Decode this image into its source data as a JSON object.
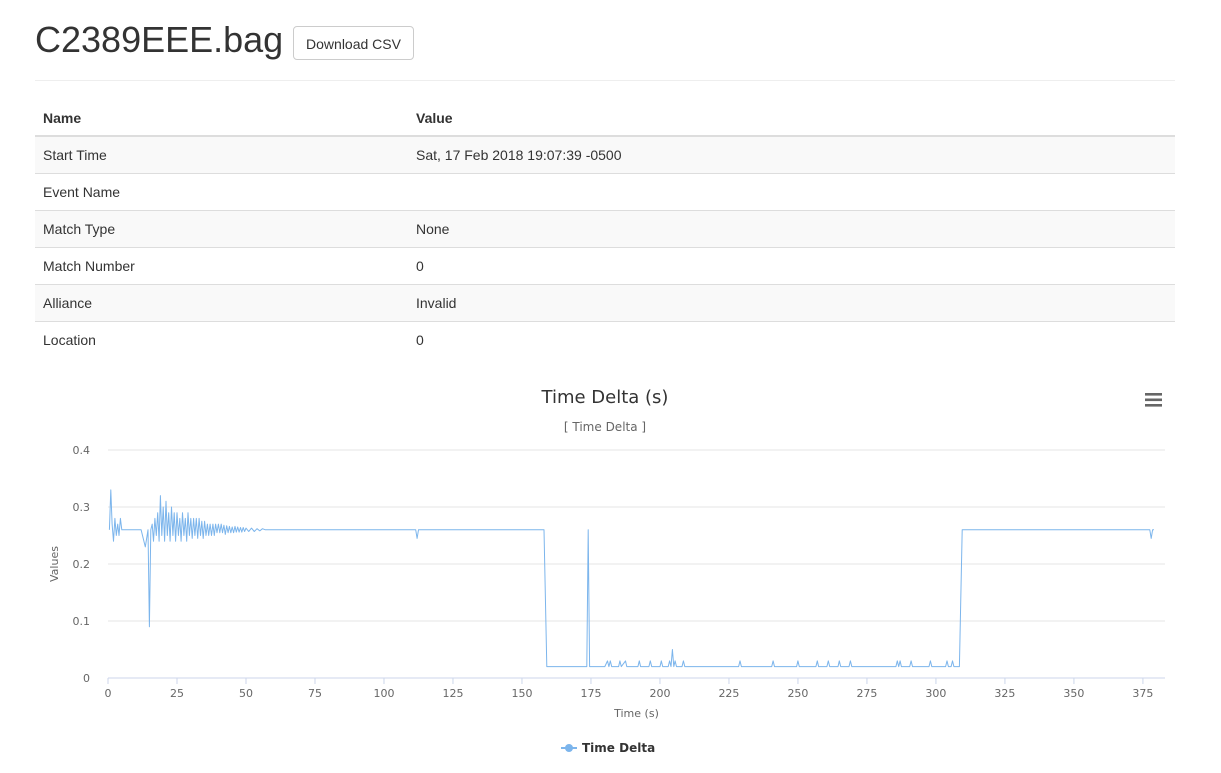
{
  "header": {
    "title": "C2389EEE.bag",
    "download_label": "Download CSV"
  },
  "table": {
    "headers": [
      "Name",
      "Value"
    ],
    "rows": [
      {
        "name": "Start Time",
        "value": "Sat, 17 Feb 2018 19:07:39 -0500"
      },
      {
        "name": "Event Name",
        "value": ""
      },
      {
        "name": "Match Type",
        "value": "None"
      },
      {
        "name": "Match Number",
        "value": "0"
      },
      {
        "name": "Alliance",
        "value": "Invalid"
      },
      {
        "name": "Location",
        "value": "0"
      }
    ]
  },
  "chart_menu_icon": "hamburger-menu-icon",
  "chart_data": {
    "type": "line",
    "title": "Time Delta (s)",
    "subtitle": "[ Time Delta ]",
    "xlabel": "Time (s)",
    "ylabel": "Values",
    "xlim": [
      0,
      383
    ],
    "ylim": [
      0,
      0.4
    ],
    "x_ticks": [
      0,
      25,
      50,
      75,
      100,
      125,
      150,
      175,
      200,
      225,
      250,
      275,
      300,
      325,
      350,
      375
    ],
    "y_ticks": [
      0,
      0.1,
      0.2,
      0.3,
      0.4
    ],
    "grid": true,
    "legend_position": "bottom-center",
    "series": [
      {
        "name": "Time Delta",
        "color": "#7cb5ec",
        "points": [
          [
            0.5,
            0.26
          ],
          [
            1.0,
            0.33
          ],
          [
            1.5,
            0.27
          ],
          [
            2.0,
            0.24
          ],
          [
            2.5,
            0.28
          ],
          [
            3.0,
            0.25
          ],
          [
            3.5,
            0.27
          ],
          [
            4.0,
            0.25
          ],
          [
            4.5,
            0.28
          ],
          [
            5.0,
            0.26
          ],
          [
            6.0,
            0.26
          ],
          [
            8.0,
            0.26
          ],
          [
            10.0,
            0.26
          ],
          [
            12.0,
            0.26
          ],
          [
            13.5,
            0.23
          ],
          [
            14.5,
            0.26
          ],
          [
            15.0,
            0.09
          ],
          [
            15.5,
            0.26
          ],
          [
            16.0,
            0.27
          ],
          [
            16.5,
            0.24
          ],
          [
            17.0,
            0.28
          ],
          [
            17.5,
            0.25
          ],
          [
            18.0,
            0.29
          ],
          [
            18.5,
            0.24
          ],
          [
            19.0,
            0.32
          ],
          [
            19.5,
            0.25
          ],
          [
            20.0,
            0.3
          ],
          [
            20.5,
            0.24
          ],
          [
            21.0,
            0.31
          ],
          [
            21.5,
            0.25
          ],
          [
            22.0,
            0.29
          ],
          [
            22.5,
            0.24
          ],
          [
            23.0,
            0.3
          ],
          [
            23.5,
            0.25
          ],
          [
            24.0,
            0.29
          ],
          [
            24.5,
            0.24
          ],
          [
            25.0,
            0.29
          ],
          [
            25.5,
            0.25
          ],
          [
            26.0,
            0.28
          ],
          [
            26.5,
            0.24
          ],
          [
            27.0,
            0.29
          ],
          [
            27.5,
            0.25
          ],
          [
            28.0,
            0.28
          ],
          [
            28.5,
            0.24
          ],
          [
            29.0,
            0.29
          ],
          [
            29.5,
            0.25
          ],
          [
            30.0,
            0.28
          ],
          [
            30.5,
            0.245
          ],
          [
            31.0,
            0.28
          ],
          [
            31.5,
            0.25
          ],
          [
            32.0,
            0.28
          ],
          [
            32.5,
            0.245
          ],
          [
            33.0,
            0.28
          ],
          [
            33.5,
            0.25
          ],
          [
            34.0,
            0.275
          ],
          [
            34.5,
            0.245
          ],
          [
            35.0,
            0.275
          ],
          [
            35.5,
            0.25
          ],
          [
            36.0,
            0.27
          ],
          [
            36.5,
            0.25
          ],
          [
            37.0,
            0.27
          ],
          [
            37.5,
            0.25
          ],
          [
            38.0,
            0.27
          ],
          [
            38.5,
            0.25
          ],
          [
            39.0,
            0.27
          ],
          [
            39.5,
            0.255
          ],
          [
            40.0,
            0.27
          ],
          [
            40.5,
            0.255
          ],
          [
            41.0,
            0.27
          ],
          [
            41.5,
            0.255
          ],
          [
            42.0,
            0.268
          ],
          [
            42.5,
            0.252
          ],
          [
            43.0,
            0.267
          ],
          [
            43.5,
            0.255
          ],
          [
            44.0,
            0.266
          ],
          [
            44.5,
            0.255
          ],
          [
            45.0,
            0.265
          ],
          [
            45.5,
            0.255
          ],
          [
            46.0,
            0.266
          ],
          [
            46.5,
            0.256
          ],
          [
            47.0,
            0.265
          ],
          [
            47.5,
            0.256
          ],
          [
            48.0,
            0.264
          ],
          [
            48.5,
            0.256
          ],
          [
            49.0,
            0.264
          ],
          [
            49.5,
            0.257
          ],
          [
            50.0,
            0.263
          ],
          [
            51.0,
            0.257
          ],
          [
            52.0,
            0.263
          ],
          [
            53.0,
            0.257
          ],
          [
            54.0,
            0.262
          ],
          [
            55.0,
            0.258
          ],
          [
            56.0,
            0.262
          ],
          [
            57.0,
            0.26
          ],
          [
            60.0,
            0.26
          ],
          [
            70.0,
            0.26
          ],
          [
            80.0,
            0.26
          ],
          [
            90.0,
            0.26
          ],
          [
            100.0,
            0.26
          ],
          [
            111.5,
            0.26
          ],
          [
            112.0,
            0.245
          ],
          [
            112.5,
            0.26
          ],
          [
            130.0,
            0.26
          ],
          [
            140.0,
            0.26
          ],
          [
            150.0,
            0.26
          ],
          [
            158.0,
            0.26
          ],
          [
            159.0,
            0.02
          ],
          [
            170.0,
            0.02
          ],
          [
            173.5,
            0.02
          ],
          [
            174.0,
            0.26
          ],
          [
            174.5,
            0.02
          ],
          [
            180.0,
            0.02
          ],
          [
            181.0,
            0.03
          ],
          [
            181.5,
            0.02
          ],
          [
            182.0,
            0.03
          ],
          [
            182.5,
            0.02
          ],
          [
            185.0,
            0.02
          ],
          [
            185.5,
            0.03
          ],
          [
            186.0,
            0.02
          ],
          [
            187.5,
            0.03
          ],
          [
            188.0,
            0.02
          ],
          [
            192.0,
            0.02
          ],
          [
            192.5,
            0.03
          ],
          [
            193.0,
            0.02
          ],
          [
            196.0,
            0.02
          ],
          [
            196.5,
            0.03
          ],
          [
            197.0,
            0.02
          ],
          [
            200.0,
            0.02
          ],
          [
            200.5,
            0.03
          ],
          [
            201.0,
            0.02
          ],
          [
            203.0,
            0.02
          ],
          [
            203.5,
            0.03
          ],
          [
            204.0,
            0.02
          ],
          [
            204.5,
            0.05
          ],
          [
            205.0,
            0.02
          ],
          [
            205.5,
            0.03
          ],
          [
            206.0,
            0.02
          ],
          [
            208.0,
            0.02
          ],
          [
            208.5,
            0.03
          ],
          [
            209.0,
            0.02
          ],
          [
            228.5,
            0.02
          ],
          [
            229.0,
            0.03
          ],
          [
            229.5,
            0.02
          ],
          [
            240.5,
            0.02
          ],
          [
            241.0,
            0.03
          ],
          [
            241.5,
            0.02
          ],
          [
            249.5,
            0.02
          ],
          [
            250.0,
            0.03
          ],
          [
            250.5,
            0.02
          ],
          [
            256.5,
            0.02
          ],
          [
            257.0,
            0.03
          ],
          [
            257.5,
            0.02
          ],
          [
            260.5,
            0.02
          ],
          [
            261.0,
            0.03
          ],
          [
            261.5,
            0.02
          ],
          [
            264.5,
            0.02
          ],
          [
            265.0,
            0.03
          ],
          [
            265.5,
            0.02
          ],
          [
            268.5,
            0.02
          ],
          [
            269.0,
            0.03
          ],
          [
            269.5,
            0.02
          ],
          [
            285.5,
            0.02
          ],
          [
            286.0,
            0.03
          ],
          [
            286.5,
            0.02
          ],
          [
            287.0,
            0.03
          ],
          [
            287.5,
            0.02
          ],
          [
            290.5,
            0.02
          ],
          [
            291.0,
            0.03
          ],
          [
            291.5,
            0.02
          ],
          [
            297.5,
            0.02
          ],
          [
            298.0,
            0.03
          ],
          [
            298.5,
            0.02
          ],
          [
            303.5,
            0.02
          ],
          [
            304.0,
            0.03
          ],
          [
            304.5,
            0.02
          ],
          [
            305.5,
            0.02
          ],
          [
            306.0,
            0.03
          ],
          [
            306.5,
            0.02
          ],
          [
            308.5,
            0.02
          ],
          [
            309.5,
            0.26
          ],
          [
            320.0,
            0.26
          ],
          [
            340.0,
            0.26
          ],
          [
            360.0,
            0.26
          ],
          [
            377.5,
            0.26
          ],
          [
            378.0,
            0.245
          ],
          [
            378.5,
            0.26
          ],
          [
            379.0,
            0.26
          ]
        ]
      }
    ]
  }
}
